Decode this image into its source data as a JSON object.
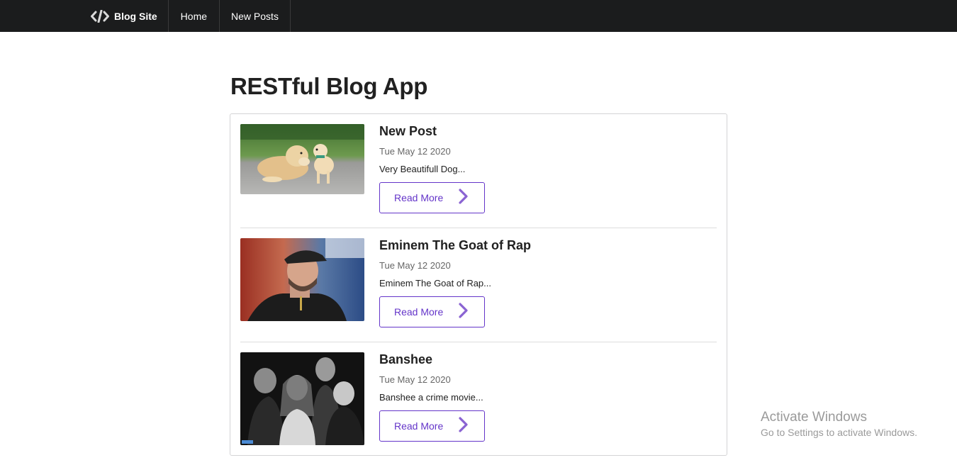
{
  "navbar": {
    "brand": "Blog Site",
    "brand_icon": "code-icon",
    "items": [
      {
        "label": "Home"
      },
      {
        "label": "New Posts"
      }
    ]
  },
  "page": {
    "title": "RESTful Blog App"
  },
  "posts": [
    {
      "title": "New Post",
      "date": "Tue May 12 2020",
      "excerpt": "Very Beautifull Dog...",
      "button_label": "Read More",
      "thumbnail": "photo-two-dogs"
    },
    {
      "title": "Eminem The Goat of Rap",
      "date": "Tue May 12 2020",
      "excerpt": "Eminem The Goat of Rap...",
      "button_label": "Read More",
      "thumbnail": "photo-man-in-cap"
    },
    {
      "title": "Banshee",
      "date": "Tue May 12 2020",
      "excerpt": "Banshee a crime movie...",
      "button_label": "Read More",
      "thumbnail": "photo-group-black-white"
    }
  ],
  "watermark": {
    "title": "Activate Windows",
    "subtitle": "Go to Settings to activate Windows."
  },
  "colors": {
    "navbar_bg": "#1b1c1d",
    "accent": "#6435c9",
    "button_icon": "#8a63d2"
  }
}
